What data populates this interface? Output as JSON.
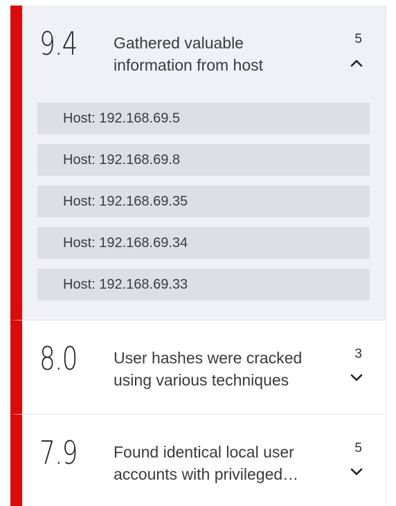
{
  "findings": [
    {
      "score": "9.4",
      "title_lines": [
        "Gathered valuable",
        "information from host"
      ],
      "count": "5",
      "expanded": true,
      "hosts": [
        "Host: 192.168.69.5",
        "Host: 192.168.69.8",
        "Host: 192.168.69.35",
        "Host: 192.168.69.34",
        "Host: 192.168.69.33"
      ]
    },
    {
      "score": "8.0",
      "title_lines": [
        "User hashes were cracked",
        "using various techniques"
      ],
      "count": "3",
      "expanded": false
    },
    {
      "score": "7.9",
      "title_lines": [
        "Found identical local user",
        "accounts with privileged…"
      ],
      "count": "5",
      "expanded": false
    }
  ],
  "icons": {
    "collapse": "chevron-up-icon",
    "expand": "chevron-down-icon"
  },
  "colors": {
    "severity_bar": "#dd0a0a",
    "expanded_bg": "#eff1f7",
    "host_row_bg": "#dcdfe6"
  }
}
